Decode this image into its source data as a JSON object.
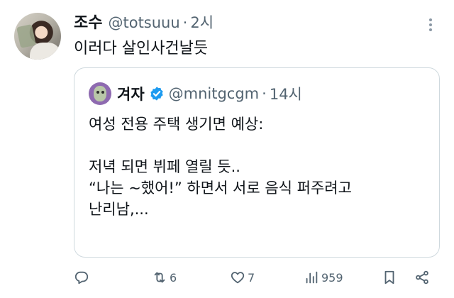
{
  "tweet": {
    "author_name": "조수",
    "author_handle": "@totsuuu",
    "separator": "·",
    "time": "2시",
    "text": "이러다 살인사건날듯"
  },
  "quoted_tweet": {
    "author_name": "겨자",
    "author_handle": "@mnitgcgm",
    "separator": "·",
    "time": "14시",
    "verified": true,
    "lines": [
      "여성 전용 주택 생기면 예상:",
      "",
      "저녁 되면 뷔페 열릴 듯..",
      "“나는 ~했어!” 하면서 서로 음식 퍼주려고",
      "난리남,..."
    ]
  },
  "actions": {
    "reply_icon": "reply-icon",
    "repost_icon": "repost-icon",
    "repost_count": "6",
    "like_icon": "heart-icon",
    "like_count": "7",
    "views_icon": "views-icon",
    "views_count": "959",
    "bookmark_icon": "bookmark-icon",
    "share_icon": "share-icon"
  },
  "colors": {
    "text": "#0f1419",
    "secondary": "#536471",
    "border": "#cfd9de",
    "verified": "#1d9bf0"
  }
}
